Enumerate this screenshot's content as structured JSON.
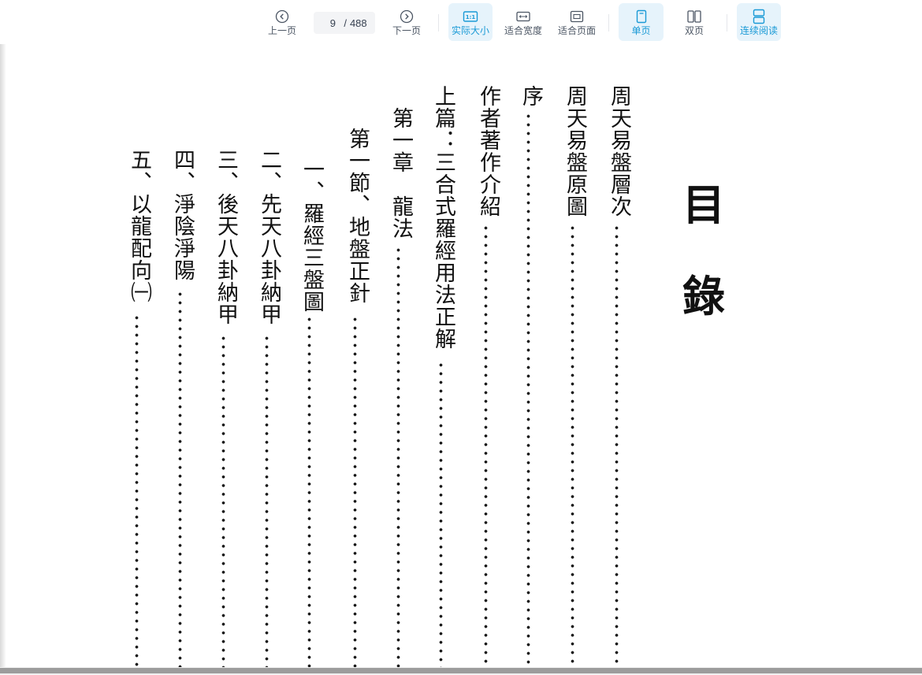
{
  "toolbar": {
    "prev_label": "上一页",
    "page_current": "9",
    "page_total": "488",
    "next_label": "下一页",
    "actual_size_label": "实际大小",
    "fit_width_label": "适合宽度",
    "fit_page_label": "适合页面",
    "single_page_label": "单页",
    "double_page_label": "双页",
    "continuous_label": "连续阅读",
    "accent_color": "#1a9ad6"
  },
  "document": {
    "title_chars": [
      "目",
      "錄"
    ],
    "toc": [
      "周天易盤層次",
      "周天易盤原圖",
      "序",
      "作者著作介紹",
      "上篇：三合式羅經用法正解",
      "第一章　龍法",
      "第一節、地盤正針",
      "一、羅經三盤圖",
      "二、先天八卦納甲",
      "三、後天八卦納甲",
      "四、淨陰淨陽",
      "五、以龍配向㈠"
    ]
  }
}
